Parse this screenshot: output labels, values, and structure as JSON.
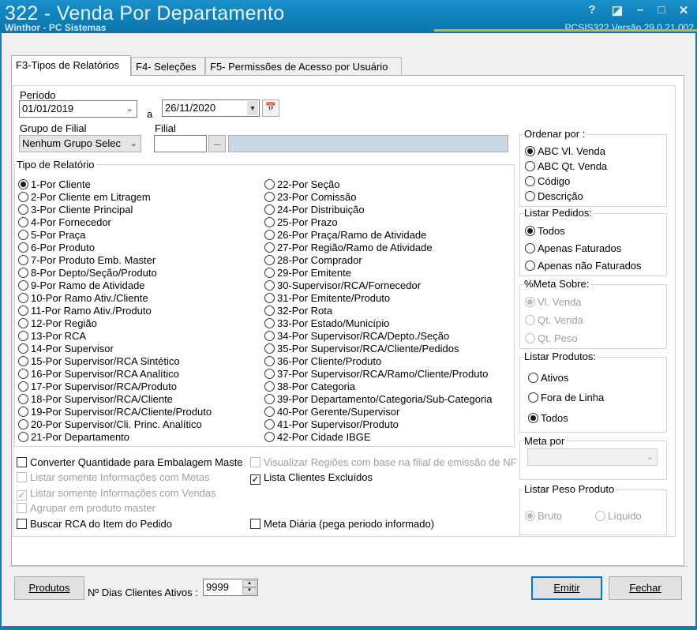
{
  "window": {
    "title": "322 - Venda Por Departamento",
    "subtitle": "Winthor - PC Sistemas",
    "version": "PCSIS322  Versão  29.0.21.002",
    "controls": [
      "?",
      "◪",
      "–",
      "□",
      "✕"
    ]
  },
  "tabs": [
    "F3-Tipos de Relatórios",
    "F4- Seleções",
    "F5- Permissões de Acesso por Usuário"
  ],
  "periodo": {
    "label": "Período",
    "from": "01/01/2019",
    "sep": "a",
    "to": "26/11/2020"
  },
  "grupo_filial": {
    "label": "Grupo de Filial",
    "value": "Nenhum Grupo Selec"
  },
  "filial": {
    "label": "Filial",
    "value": "",
    "btn": "..."
  },
  "tipo_relatorio": {
    "title": "Tipo de Relatório",
    "left": [
      "1-Por Cliente",
      "2-Por Cliente em Litragem",
      "3-Por Cliente Principal",
      "4-Por Fornecedor",
      "5-Por Praça",
      "6-Por Produto",
      "7-Por Produto Emb. Master",
      "8-Por Depto/Seção/Produto",
      "9-Por Ramo de Atividade",
      "10-Por Ramo Ativ./Cliente",
      "11-Por Ramo Ativ./Produto",
      "12-Por Região",
      "13-Por RCA",
      "14-Por Supervisor",
      "15-Por Supervisor/RCA Sintético",
      "16-Por Supervisor/RCA Analítico",
      "17-Por Supervisor/RCA/Produto",
      "18-Por Supervisor/RCA/Cliente",
      "19-Por Supervisor/RCA/Cliente/Produto",
      "20-Por Supervisor/Cli. Princ. Analítico",
      "21-Por Departamento"
    ],
    "right": [
      "22-Por Seção",
      "23-Por Comissão",
      "24-Por Distribuição",
      "25-Por Prazo",
      "26-Por Praça/Ramo de Atividade",
      "27-Por Região/Ramo de Atividade",
      "28-Por Comprador",
      "29-Por Emitente",
      "30-Supervisor/RCA/Fornecedor",
      "31-Por Emitente/Produto",
      "32-Por Rota",
      "33-Por Estado/Município",
      "34-Por Supervisor/RCA/Depto./Seção",
      "35-Por Supervisor/RCA/Cliente/Pedidos",
      "36-Por Cliente/Produto",
      "37-Por Supervisor/RCA/Ramo/Cliente/Produto",
      "38-Por Categoria",
      "39-Por Departamento/Categoria/Sub-Categoria",
      "40-Por Gerente/Supervisor",
      "41-Por Supervisor/Produto",
      "42-Por Cidade IBGE"
    ],
    "selected": "1-Por Cliente"
  },
  "checks_left": [
    {
      "label": "Converter Quantidade para Embalagem Maste",
      "checked": false,
      "enabled": true
    },
    {
      "label": "Listar somente Informações com Metas",
      "checked": false,
      "enabled": false
    },
    {
      "label": "Listar somente Informações com Vendas",
      "checked": true,
      "enabled": false
    },
    {
      "label": "Agrupar em produto master",
      "checked": false,
      "enabled": false
    },
    {
      "label": "Buscar RCA do Item do Pedido",
      "checked": false,
      "enabled": true
    }
  ],
  "checks_right": [
    {
      "label": "Visualizar Regiões com base na filial de emissão de NF",
      "checked": false,
      "enabled": false
    },
    {
      "label": "Lista Clientes Excluídos",
      "checked": true,
      "enabled": true
    },
    {
      "label": "Meta Diária (pega periodo informado)",
      "checked": false,
      "enabled": true
    }
  ],
  "ordenar_por": {
    "title": "Ordenar por :",
    "options": [
      "ABC Vl. Venda",
      "ABC Qt. Venda",
      "Código",
      "Descrição"
    ],
    "selected": "ABC Vl. Venda"
  },
  "listar_pedidos": {
    "title": "Listar Pedidos:",
    "options": [
      "Todos",
      "Apenas Faturados",
      "Apenas não Faturados"
    ],
    "selected": "Todos"
  },
  "meta_sobre": {
    "title": "%Meta Sobre:",
    "options": [
      "Vl. Venda",
      "Qt. Venda",
      "Qt. Peso"
    ],
    "selected": "Vl. Venda"
  },
  "listar_produtos": {
    "title": "Listar Produtos:",
    "options": [
      "Ativos",
      "Fora de Linha",
      "Todos"
    ],
    "selected": "Todos"
  },
  "meta_por": {
    "title": "Meta por",
    "value": ""
  },
  "listar_peso": {
    "title": "Listar Peso Produto",
    "options": [
      "Bruto",
      "Líquido"
    ],
    "selected": "Bruto"
  },
  "footer": {
    "produtos_btn": "Produtos",
    "dias_label": "Nº Dias Clientes Ativos :",
    "dias_value": "9999",
    "emitir_btn": "Emitir",
    "fechar_btn": "Fechar"
  }
}
